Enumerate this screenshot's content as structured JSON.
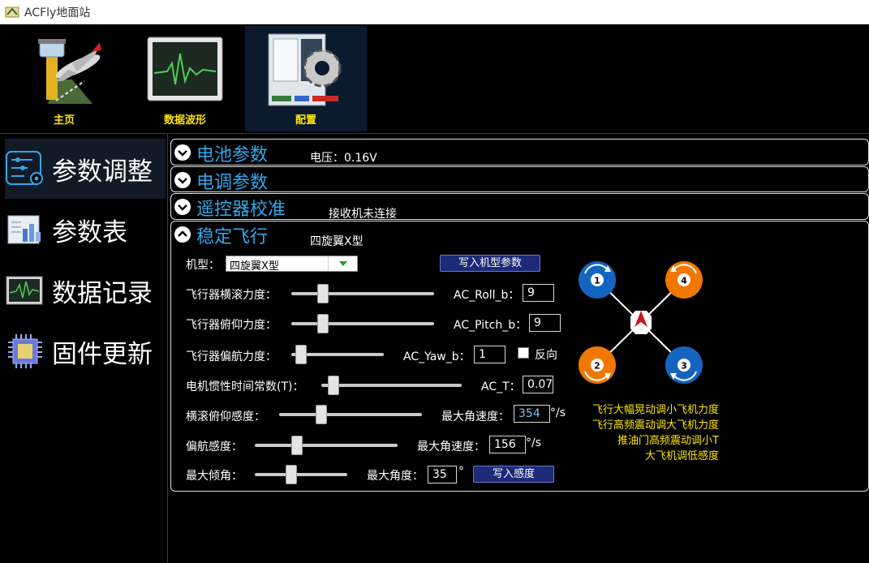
{
  "window": {
    "title": "ACFly地面站"
  },
  "toolbar": {
    "items": [
      {
        "label": "主页",
        "icon": "airport-tower-icon"
      },
      {
        "label": "数据波形",
        "icon": "waveform-monitor-icon"
      },
      {
        "label": "配置",
        "icon": "gear-config-icon"
      }
    ],
    "active": "配置"
  },
  "sidebar": {
    "items": [
      {
        "label": "参数调整",
        "icon": "parameter-sliders-icon"
      },
      {
        "label": "参数表",
        "icon": "bar-table-icon"
      },
      {
        "label": "数据记录",
        "icon": "data-log-icon"
      },
      {
        "label": "固件更新",
        "icon": "chip-icon"
      }
    ],
    "active": "参数调整"
  },
  "sections": {
    "battery": {
      "title": "电池参数",
      "info": "电压：0.16V"
    },
    "esc": {
      "title": "电调参数"
    },
    "rc": {
      "title": "遥控器校准",
      "info": "接收机未连接"
    },
    "stable": {
      "title": "稳定飞行",
      "info": "四旋翼X型"
    }
  },
  "stable_form": {
    "airframe_label": "机型：",
    "airframe_value": "四旋翼X型",
    "write_airframe_button": "写入机型参数",
    "roll_label": "飞行器横滚力度：",
    "roll_slider": 0.2,
    "roll_param_label": "AC_Roll_b：",
    "roll_param_value": "9",
    "pitch_label": "飞行器俯仰力度：",
    "pitch_slider": 0.2,
    "pitch_param_label": "AC_Pitch_b：",
    "pitch_param_value": "9",
    "yaw_label": "飞行器偏航力度：",
    "yaw_slider": 0.05,
    "yaw_param_label": "AC_Yaw_b：",
    "yaw_param_value": "1",
    "reverse_label": "反向",
    "reverse_checked": false,
    "motor_t_label": "电机惯性时间常数(T)：",
    "motor_t_slider": 0.05,
    "motor_t_param_label": "AC_T：",
    "motor_t_param_value": "0.07",
    "rp_sens_label": "横滚俯仰感度：",
    "rp_sens_slider": 0.28,
    "rp_rate_label": "最大角速度：",
    "rp_rate_value": "354",
    "rp_rate_unit": "°/s",
    "yaw_sens_label": "偏航感度：",
    "yaw_sens_slider": 0.28,
    "yaw_rate_label": "最大角速度：",
    "yaw_rate_value": "156",
    "yaw_rate_unit": "°/s",
    "max_tilt_label": "最大倾角：",
    "max_tilt_slider": 0.38,
    "max_angle_label": "最大角度：",
    "max_angle_value": "35",
    "max_angle_unit": "°",
    "write_sens_button": "写入感度"
  },
  "diagram": {
    "motors": [
      "1",
      "2",
      "3",
      "4"
    ],
    "colors": {
      "blue": "#1565c0",
      "orange": "#f07800",
      "arrow": "#c8161d"
    }
  },
  "tips": [
    "飞行大幅晃动调小飞机力度",
    "飞行高频震动调大飞机力度",
    "推油门高频震动调小T",
    "大飞机调低感度"
  ]
}
